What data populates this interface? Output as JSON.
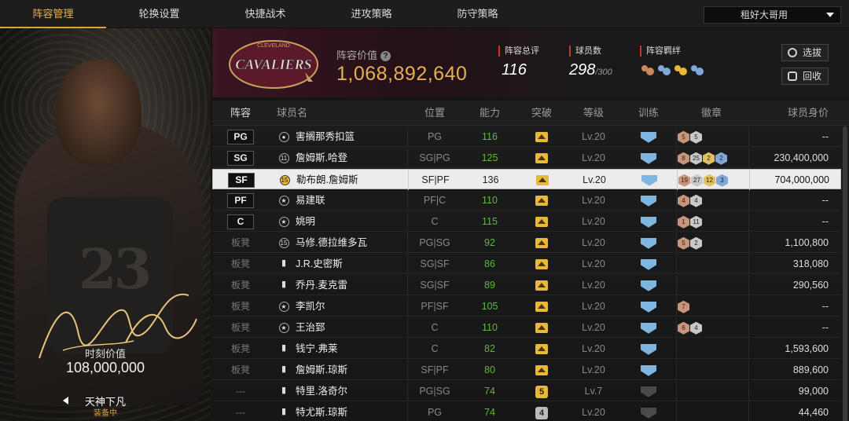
{
  "nav": {
    "tabs": [
      "阵容管理",
      "轮换设置",
      "快捷战术",
      "进攻策略",
      "防守策略"
    ],
    "active_tab": 0,
    "dropdown_value": "租好大哥用"
  },
  "player_card": {
    "jersey_number": "23",
    "value_label": "时刻价值",
    "value": "108,000,000",
    "card_name": "天神下凡",
    "equipped": "装备中"
  },
  "team": {
    "logo_text": "CAVALIERS",
    "logo_sub": "CLEVELAND",
    "value_label": "阵容价值",
    "value": "1,068,892,640",
    "rating_label": "阵容总评",
    "rating": "116",
    "players_label": "球员数",
    "players": "298",
    "players_max": "/300",
    "bond_label": "阵容羁绊",
    "bond_icons": [
      "#c9895a",
      "#7fa7d8",
      "#e8b83a",
      "#7fa7d8"
    ],
    "select_button": "选拔",
    "recycle_button": "回收"
  },
  "table": {
    "headers": [
      "阵容",
      "球员名",
      "位置",
      "能力",
      "突破",
      "等级",
      "训练",
      "徽章",
      "球员身价"
    ],
    "rows": [
      {
        "slot": "PG",
        "bench": false,
        "icon": "person",
        "name": "害搁那秀扣篮",
        "pos": "PG",
        "ability": "116",
        "break": "crown",
        "level": "Lv.20",
        "train": "blue",
        "badges": [
          [
            "5",
            "#c9957a"
          ],
          [
            "5",
            "#c8c8c8"
          ]
        ],
        "value": "--"
      },
      {
        "slot": "SG",
        "bench": false,
        "icon": "11",
        "name": "詹姆斯.哈登",
        "pos": "SG|PG",
        "ability": "125",
        "break": "crown",
        "level": "Lv.20",
        "train": "blue",
        "badges": [
          [
            "8",
            "#c9957a"
          ],
          [
            "25",
            "#c8c8c8"
          ],
          [
            "2",
            "#e0c060"
          ],
          [
            "2",
            "#7fa7d8"
          ]
        ],
        "value": "230,400,000"
      },
      {
        "slot": "SF",
        "bench": false,
        "icon": "15",
        "name": "勒布朗.詹姆斯",
        "pos": "SF|PF",
        "ability": "136",
        "break": "crown",
        "level": "Lv.20",
        "train": "blue",
        "badges": [
          [
            "19",
            "#c9957a"
          ],
          [
            "27",
            "#c8c8c8"
          ],
          [
            "12",
            "#e0c060"
          ],
          [
            "3",
            "#7fa7d8"
          ]
        ],
        "value": "704,000,000",
        "selected": true
      },
      {
        "slot": "PF",
        "bench": false,
        "icon": "star",
        "name": "易建联",
        "pos": "PF|C",
        "ability": "110",
        "break": "crown",
        "level": "Lv.20",
        "train": "blue",
        "badges": [
          [
            "4",
            "#c9957a"
          ],
          [
            "4",
            "#c8c8c8"
          ]
        ],
        "value": "--"
      },
      {
        "slot": "C",
        "bench": false,
        "icon": "star",
        "name": "姚明",
        "pos": "C",
        "ability": "115",
        "break": "crown",
        "level": "Lv.20",
        "train": "blue",
        "badges": [
          [
            "1",
            "#c9957a"
          ],
          [
            "11",
            "#c8c8c8"
          ]
        ],
        "value": "--"
      },
      {
        "slot": "板凳",
        "bench": true,
        "icon": "15",
        "name": "马修.德拉维多瓦",
        "pos": "PG|SG",
        "ability": "92",
        "break": "crown",
        "level": "Lv.20",
        "train": "blue",
        "badges": [
          [
            "5",
            "#c9957a"
          ],
          [
            "2",
            "#c8c8c8"
          ]
        ],
        "value": "1,100,800"
      },
      {
        "slot": "板凳",
        "bench": true,
        "icon": "bars",
        "name": "J.R.史密斯",
        "pos": "SG|SF",
        "ability": "86",
        "break": "crown",
        "level": "Lv.20",
        "train": "blue",
        "badges": [],
        "value": "318,080"
      },
      {
        "slot": "板凳",
        "bench": true,
        "icon": "bars",
        "name": "乔丹.麦克雷",
        "pos": "SG|SF",
        "ability": "89",
        "break": "crown",
        "level": "Lv.20",
        "train": "blue",
        "badges": [],
        "value": "290,560"
      },
      {
        "slot": "板凳",
        "bench": true,
        "icon": "star",
        "name": "李凯尔",
        "pos": "PF|SF",
        "ability": "105",
        "break": "crown",
        "level": "Lv.20",
        "train": "blue",
        "badges": [
          [
            "7",
            "#c9957a"
          ]
        ],
        "value": "--"
      },
      {
        "slot": "板凳",
        "bench": true,
        "icon": "star",
        "name": "王治郅",
        "pos": "C",
        "ability": "110",
        "break": "crown",
        "level": "Lv.20",
        "train": "blue",
        "badges": [
          [
            "6",
            "#c9957a"
          ],
          [
            "4",
            "#c8c8c8"
          ]
        ],
        "value": "--"
      },
      {
        "slot": "板凳",
        "bench": true,
        "icon": "bars",
        "name": "钱宁.弗莱",
        "pos": "C",
        "ability": "82",
        "break": "crown",
        "level": "Lv.20",
        "train": "blue",
        "badges": [],
        "value": "1,593,600"
      },
      {
        "slot": "板凳",
        "bench": true,
        "icon": "bars",
        "name": "詹姆斯.琼斯",
        "pos": "SF|PF",
        "ability": "80",
        "break": "crown",
        "level": "Lv.20",
        "train": "blue",
        "badges": [],
        "value": "889,600"
      },
      {
        "slot": "---",
        "bench": true,
        "icon": "bars",
        "name": "特里.洛奇尔",
        "pos": "PG|SG",
        "ability": "74",
        "break": "5",
        "level": "Lv.7",
        "train": "gray",
        "badges": [],
        "value": "99,000"
      },
      {
        "slot": "---",
        "bench": true,
        "icon": "bars",
        "name": "特尤斯.琼斯",
        "pos": "PG",
        "ability": "74",
        "break": "4",
        "level": "Lv.20",
        "train": "gray",
        "badges": [],
        "value": "44,460"
      }
    ]
  }
}
